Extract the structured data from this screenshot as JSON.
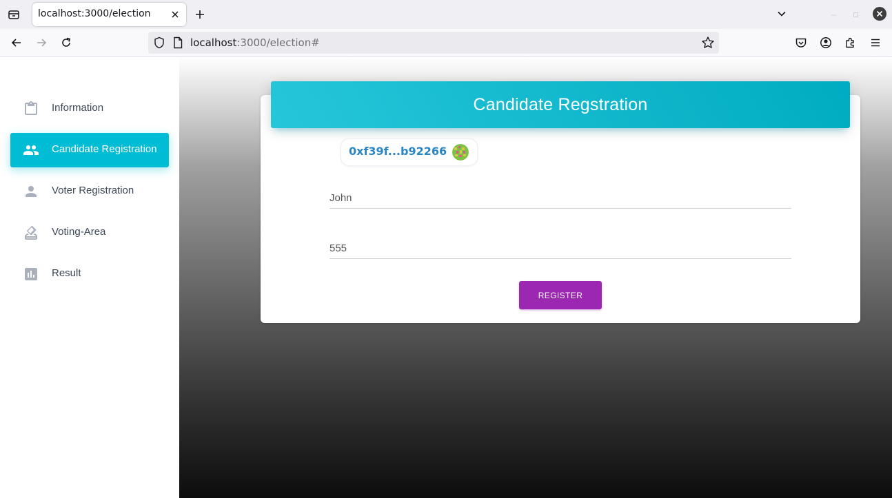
{
  "browser": {
    "tab_title": "localhost:3000/election",
    "url_host": "localhost",
    "url_rest": ":3000/election#",
    "icons": {
      "tab_list": "tab-list-icon",
      "close_tab": "close-icon",
      "new_tab": "plus-icon",
      "list_all_tabs": "chevron-down-icon",
      "back": "arrow-left-icon",
      "forward": "arrow-right-icon",
      "reload": "reload-icon",
      "shield": "shield-icon",
      "page": "page-icon",
      "bookmark": "star-icon",
      "pocket": "pocket-icon",
      "account": "account-icon",
      "extensions": "puzzle-icon",
      "menu": "hamburger-icon"
    }
  },
  "sidebar": {
    "items": [
      {
        "label": "Information",
        "icon": "clipboard-icon",
        "active": false
      },
      {
        "label": "Candidate Registration",
        "icon": "people-icon",
        "active": true
      },
      {
        "label": "Voter Registration",
        "icon": "person-icon",
        "active": false
      },
      {
        "label": "Voting-Area",
        "icon": "ballot-icon",
        "active": false
      },
      {
        "label": "Result",
        "icon": "bar-chart-icon",
        "active": false
      }
    ]
  },
  "card": {
    "title": "Candidate Regstration",
    "account": {
      "address": "0xf39f...b92266",
      "avatar_icon": "identicon-avatar"
    },
    "name_field": {
      "value": "John"
    },
    "age_field": {
      "value": "555"
    },
    "register_label": "REGISTER"
  },
  "colors": {
    "accent": "#00bcd4",
    "header_gradient_start": "#26c6da",
    "header_gradient_end": "#00acc1",
    "button": "#9c27b0",
    "address": "#2b86c5"
  }
}
